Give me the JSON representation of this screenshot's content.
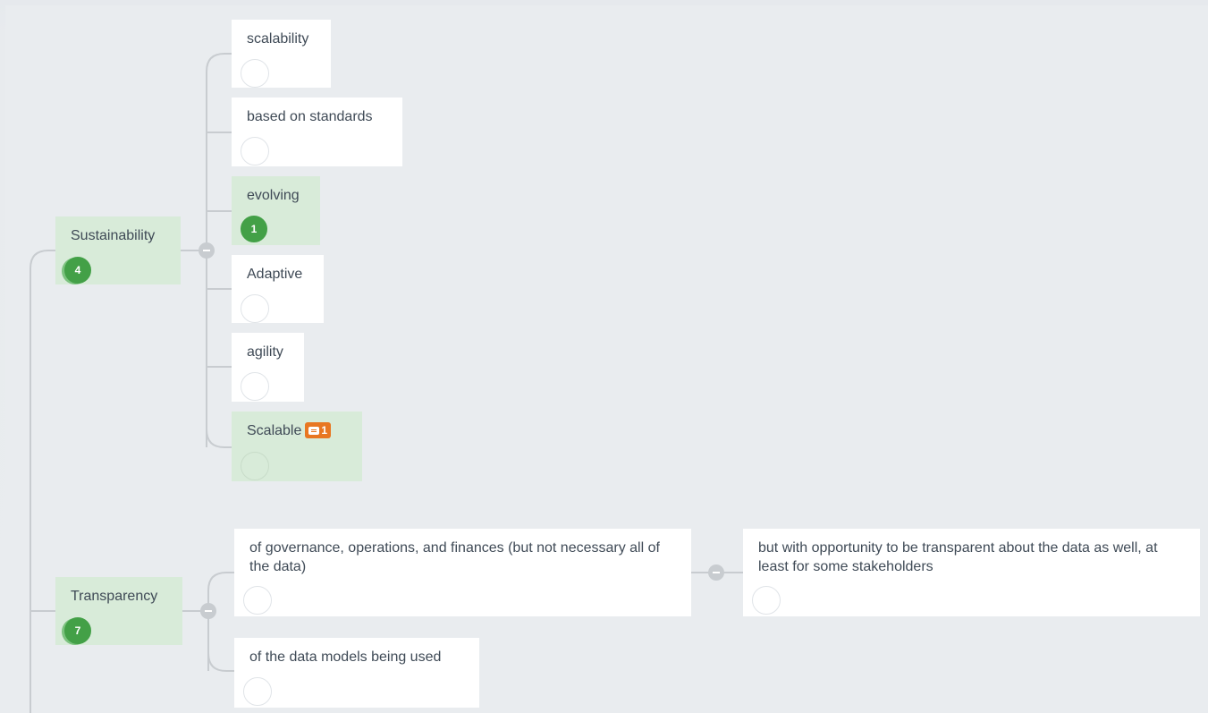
{
  "mindmap": {
    "nodes": {
      "scalability": {
        "label": "scalability",
        "votes": ""
      },
      "based_on_standards": {
        "label": "based on standards",
        "votes": ""
      },
      "evolving": {
        "label": "evolving",
        "votes": "1"
      },
      "sustainability": {
        "label": "Sustainability",
        "votes": "4"
      },
      "adaptive": {
        "label": "Adaptive",
        "votes": ""
      },
      "agility": {
        "label": "agility",
        "votes": ""
      },
      "scalable": {
        "label": "Scalable",
        "votes": "",
        "comments": "1"
      },
      "governance": {
        "label": "of governance, operations, and finances (but not necessary all of the data)",
        "votes": ""
      },
      "opportunity": {
        "label": "but with opportunity to be transparent about the data as well, at least for some stakeholders",
        "votes": ""
      },
      "transparency": {
        "label": "Transparency",
        "votes": "7"
      },
      "data_models": {
        "label": "of the data models being used",
        "votes": ""
      }
    }
  },
  "colors": {
    "canvas": "#e9ecef",
    "node_default": "#ffffff",
    "node_voted": "#d8ebd9",
    "vote_badge": "#43a047",
    "comment_badge": "#e87722",
    "connector": "#c8ccd0"
  },
  "icons": {
    "collapse": "minus-circle-icon",
    "comment": "chat-bubble-icon"
  }
}
